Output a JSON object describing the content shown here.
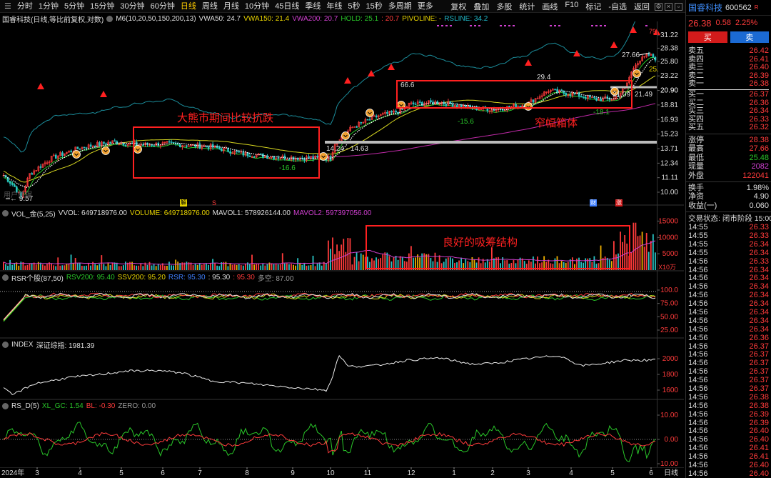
{
  "toolbar": {
    "menu_icon": "menu-icon",
    "tabs": [
      "分时",
      "1分钟",
      "5分钟",
      "15分钟",
      "30分钟",
      "60分钟",
      "日线",
      "周线",
      "月线",
      "10分钟",
      "45日线",
      "季线",
      "年线",
      "5秒",
      "15秒",
      "多周期",
      "更多"
    ],
    "active_tab": 6,
    "tools": [
      "复权",
      "叠加",
      "多股",
      "统计",
      "画线",
      "F10",
      "标记",
      "-自选",
      "返回"
    ]
  },
  "main_legend": {
    "title": "国睿科技(日线,等比前复权,对数)",
    "ma": "M6(10,20,50,150,200,13)",
    "vwa50": "VWA50: 24.7",
    "vwa150": "VWA150: 21.4",
    "vwa200": "VWA200: 20.7",
    "hold": "HOLD: 25.1",
    "hold2": ": 20.7",
    "pivoline": "PIVOLINE: -",
    "rsline": "RSLINE: 34.2"
  },
  "main_axis": [
    "31.22",
    "28.38",
    "25.80",
    "23.22",
    "20.90",
    "18.81",
    "16.93",
    "15.23",
    "13.71",
    "12.34",
    "11.11",
    "10.00"
  ],
  "main_annotations": {
    "box1_label": "大熊市期间比较抗跌",
    "box2_label": "窄幅箱体",
    "box3_label": "良好的吸筹结构",
    "low_label": "← 9.57",
    "range_label": "14.24 - 14.63",
    "val_166": "-16.6",
    "val_664": "66.6",
    "val_156": "-15.6",
    "val_294": "29.4",
    "val_181": "-18.1",
    "val_2109": "21.09",
    "val_2149": "21.49",
    "val_2766": "27.66",
    "val_25": "25.",
    "val_79": "79.",
    "no_data": "用户数据",
    "marker_jie": "解",
    "marker_s": "S",
    "marker_cai": "财",
    "marker_zhang": "涨"
  },
  "vol_legend": {
    "title": "VOL_金(5,25)",
    "vvol": "VVOL: 649718976.00",
    "volume": "VOLUME: 649718976.00",
    "mavol1": "MAVOL1: 578926144.00",
    "mavol2": "MAVOL2: 597397056.00"
  },
  "vol_axis": [
    "15000",
    "10000",
    "5000"
  ],
  "vol_unit": "X10万",
  "rsr_legend": {
    "title": "RSR个股(87,50)",
    "rsv": "RSV200: 95.40",
    "ssv": "SSV200: 95.20",
    "rsr": "RSR: 95.30",
    "v1": ": 95.30",
    "v2": ": 95.30",
    "dk": "多空: 87.00"
  },
  "rsr_axis": [
    "100.0",
    "75.00",
    "50.00",
    "25.00"
  ],
  "index_legend": {
    "title": "INDEX",
    "value": "深证综指: 1981.39"
  },
  "index_axis": [
    "2000",
    "1800",
    "1600"
  ],
  "rsd_legend": {
    "title": "RS_D(5)",
    "xl": "XL_GC: 1.54",
    "bl": "BL: -0.30",
    "zero": "ZERO: 0.00"
  },
  "rsd_axis": [
    "10.00",
    "0.00",
    "-10.00"
  ],
  "xaxis": {
    "year": "2024年",
    "months": [
      "3",
      "4",
      "5",
      "6",
      "7",
      "8",
      "9",
      "10",
      "11",
      "12",
      "1",
      "2",
      "3",
      "4",
      "5",
      "6"
    ],
    "period": "日线"
  },
  "panel": {
    "name": "国睿科技",
    "code": "600562",
    "badge": "R",
    "price": "26.38",
    "change": "0.58",
    "pct": "2.25%",
    "buy": "买",
    "sell": "卖",
    "asks": [
      {
        "label": "卖五",
        "price": "26.42"
      },
      {
        "label": "卖四",
        "price": "26.41"
      },
      {
        "label": "卖三",
        "price": "26.40"
      },
      {
        "label": "卖二",
        "price": "26.39"
      },
      {
        "label": "卖一",
        "price": "26.38"
      }
    ],
    "bids": [
      {
        "label": "买一",
        "price": "26.37"
      },
      {
        "label": "买二",
        "price": "26.36"
      },
      {
        "label": "买三",
        "price": "26.34"
      },
      {
        "label": "买四",
        "price": "26.33"
      },
      {
        "label": "买五",
        "price": "26.32"
      }
    ],
    "stats": [
      {
        "label": "涨停",
        "value": "28.38",
        "color": "#ff3b3b"
      },
      {
        "label": "最高",
        "value": "27.66",
        "color": "#ff3b3b"
      },
      {
        "label": "最低",
        "value": "25.48",
        "color": "#29c629"
      },
      {
        "label": "现量",
        "value": "2082",
        "color": "#d040d0"
      },
      {
        "label": "外盘",
        "value": "122041",
        "color": "#ff3b3b"
      }
    ],
    "stats2": [
      {
        "label": "换手",
        "value": "1.98%",
        "color": "#ddd"
      },
      {
        "label": "净资",
        "value": "4.90",
        "color": "#ddd"
      },
      {
        "label": "收益(一)",
        "value": "0.060",
        "color": "#ddd"
      }
    ],
    "trade_status": "交易状态: 闭市阶段 15:00",
    "ticks": [
      {
        "t": "14:55",
        "v": "26.33"
      },
      {
        "t": "14:55",
        "v": "26.33"
      },
      {
        "t": "14:55",
        "v": "26.34"
      },
      {
        "t": "14:55",
        "v": "26.34"
      },
      {
        "t": "14:56",
        "v": "26.33"
      },
      {
        "t": "14:56",
        "v": "26.34"
      },
      {
        "t": "14:56",
        "v": "26.34"
      },
      {
        "t": "14:56",
        "v": "26.34"
      },
      {
        "t": "14:56",
        "v": "26.34"
      },
      {
        "t": "14:56",
        "v": "26.34"
      },
      {
        "t": "14:56",
        "v": "26.34"
      },
      {
        "t": "14:56",
        "v": "26.34"
      },
      {
        "t": "14:56",
        "v": "26.34"
      },
      {
        "t": "14:56",
        "v": "26.36"
      },
      {
        "t": "14:56",
        "v": "26.37"
      },
      {
        "t": "14:56",
        "v": "26.37"
      },
      {
        "t": "14:56",
        "v": "26.37"
      },
      {
        "t": "14:56",
        "v": "26.37"
      },
      {
        "t": "14:56",
        "v": "26.37"
      },
      {
        "t": "14:56",
        "v": "26.37"
      },
      {
        "t": "14:56",
        "v": "26.38"
      },
      {
        "t": "14:56",
        "v": "26.38"
      },
      {
        "t": "14:56",
        "v": "26.39"
      },
      {
        "t": "14:56",
        "v": "26.39"
      },
      {
        "t": "14:56",
        "v": "26.40"
      },
      {
        "t": "14:56",
        "v": "26.40"
      },
      {
        "t": "14:56",
        "v": "26.41"
      },
      {
        "t": "14:56",
        "v": "26.41"
      },
      {
        "t": "14:56",
        "v": "26.40"
      },
      {
        "t": "14:56",
        "v": "26.40"
      },
      {
        "t": "14:56",
        "v": "26.38"
      }
    ]
  },
  "colors": {
    "up": "#ff3b3b",
    "down": "#29c629",
    "accent": "#ffcc00",
    "blue": "#3f8fff",
    "cyan": "#20b8c8",
    "magenta": "#d040d0"
  }
}
